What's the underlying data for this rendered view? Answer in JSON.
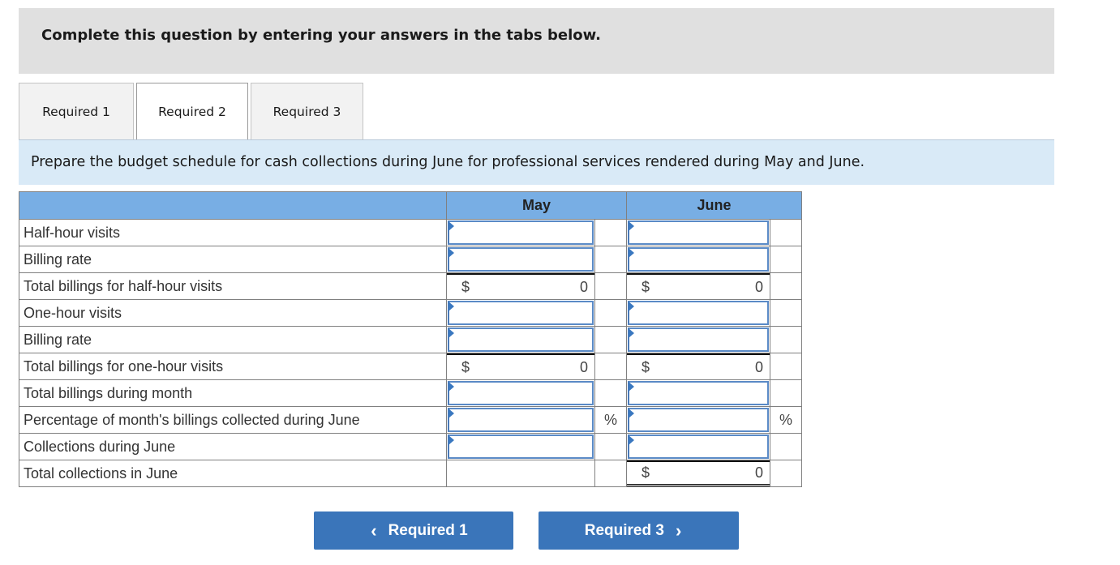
{
  "banner": {
    "text": "Complete this question by entering your answers in the tabs below."
  },
  "tabs": [
    {
      "label": "Required 1",
      "active": false
    },
    {
      "label": "Required 2",
      "active": true
    },
    {
      "label": "Required 3",
      "active": false
    }
  ],
  "instruction": "Prepare the budget schedule for cash collections during June for professional services rendered during May and June.",
  "schedule": {
    "columns": [
      "",
      "May",
      "June"
    ],
    "rows": [
      {
        "label": "Half-hour visits",
        "may": {
          "type": "input",
          "value": ""
        },
        "june": {
          "type": "input",
          "value": ""
        }
      },
      {
        "label": "Billing rate",
        "may": {
          "type": "input",
          "value": ""
        },
        "june": {
          "type": "input",
          "value": ""
        }
      },
      {
        "label": "Total billings for half-hour visits",
        "may": {
          "type": "calc",
          "prefix": "$",
          "value": "0"
        },
        "june": {
          "type": "calc",
          "prefix": "$",
          "value": "0"
        }
      },
      {
        "label": "One-hour visits",
        "may": {
          "type": "input",
          "value": ""
        },
        "june": {
          "type": "input",
          "value": ""
        }
      },
      {
        "label": "Billing rate",
        "may": {
          "type": "input",
          "value": ""
        },
        "june": {
          "type": "input",
          "value": ""
        }
      },
      {
        "label": "Total billings for one-hour visits",
        "may": {
          "type": "calc",
          "prefix": "$",
          "value": "0"
        },
        "june": {
          "type": "calc",
          "prefix": "$",
          "value": "0"
        }
      },
      {
        "label": "Total billings during month",
        "may": {
          "type": "input",
          "value": ""
        },
        "june": {
          "type": "input",
          "value": ""
        }
      },
      {
        "label": "Percentage of month's billings collected during June",
        "may": {
          "type": "input",
          "value": "",
          "unit": "%"
        },
        "june": {
          "type": "input",
          "value": "",
          "unit": "%"
        }
      },
      {
        "label": "Collections during June",
        "may": {
          "type": "input",
          "value": ""
        },
        "june": {
          "type": "input",
          "value": ""
        }
      },
      {
        "label": "Total collections in June",
        "may": {
          "type": "empty"
        },
        "june": {
          "type": "calc",
          "prefix": "$",
          "value": "0",
          "double": true
        }
      }
    ]
  },
  "nav": {
    "prev_label": "Required 1",
    "next_label": "Required 3",
    "prev_icon": "chevron-left-icon",
    "next_icon": "chevron-right-icon"
  },
  "colors": {
    "header_blue": "#78aee4",
    "button_blue": "#3a75ba",
    "instruction_bg": "#d9eaf7",
    "banner_bg": "#e0e0e0"
  }
}
